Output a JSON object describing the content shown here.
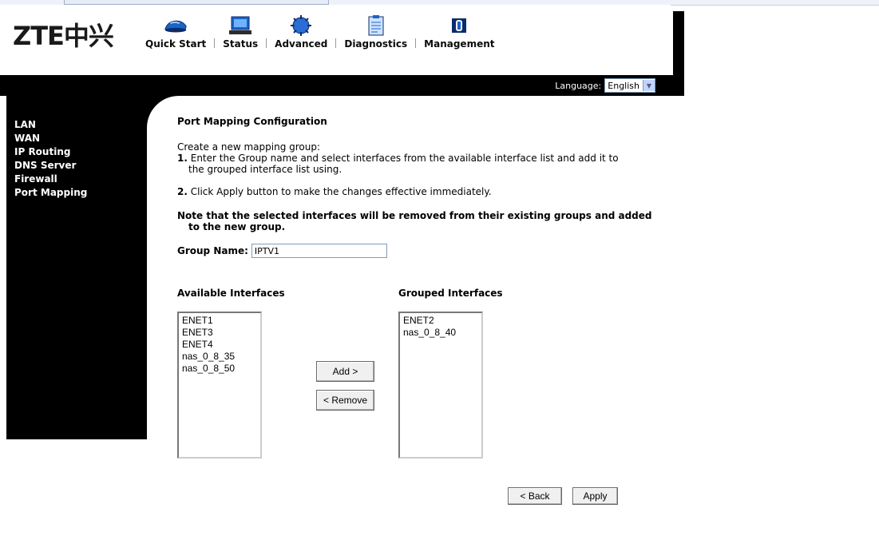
{
  "logo": "ZTE中兴",
  "nav": [
    {
      "label": "Quick Start",
      "icon": "car-icon"
    },
    {
      "label": "Status",
      "icon": "computer-icon"
    },
    {
      "label": "Advanced",
      "icon": "chip-icon"
    },
    {
      "label": "Diagnostics",
      "icon": "clipboard-icon"
    },
    {
      "label": "Management",
      "icon": "book-icon"
    }
  ],
  "language": {
    "label": "Language:",
    "value": "English"
  },
  "sidebar": {
    "items": [
      "LAN",
      "WAN",
      "IP Routing",
      "DNS Server",
      "Firewall",
      "Port Mapping"
    ]
  },
  "content": {
    "title": "Port Mapping Configuration",
    "intro": "Create a new mapping group:",
    "step1_num": "1.",
    "step1_a": " Enter the Group name and select interfaces from the available interface list and add it to",
    "step1_b": "the grouped interface list using.",
    "step2_num": "2.",
    "step2": " Click Apply button to make the changes effective immediately.",
    "note_a": "Note that the selected interfaces will be removed from their existing groups and added",
    "note_b": "to the new group.",
    "group_label": "Group Name:",
    "group_value": "IPTV1"
  },
  "available": {
    "label": "Available Interfaces",
    "items": [
      "ENET1",
      "ENET3",
      "ENET4",
      "nas_0_8_35",
      "nas_0_8_50"
    ]
  },
  "grouped": {
    "label": "Grouped Interfaces",
    "items": [
      "ENET2",
      "nas_0_8_40"
    ]
  },
  "buttons": {
    "add": "Add >",
    "remove": "< Remove",
    "back": "< Back",
    "apply": "Apply"
  },
  "colors": {
    "header_black": "#000000",
    "background": "#ffffff",
    "sidebar_text": "#ffffff"
  }
}
